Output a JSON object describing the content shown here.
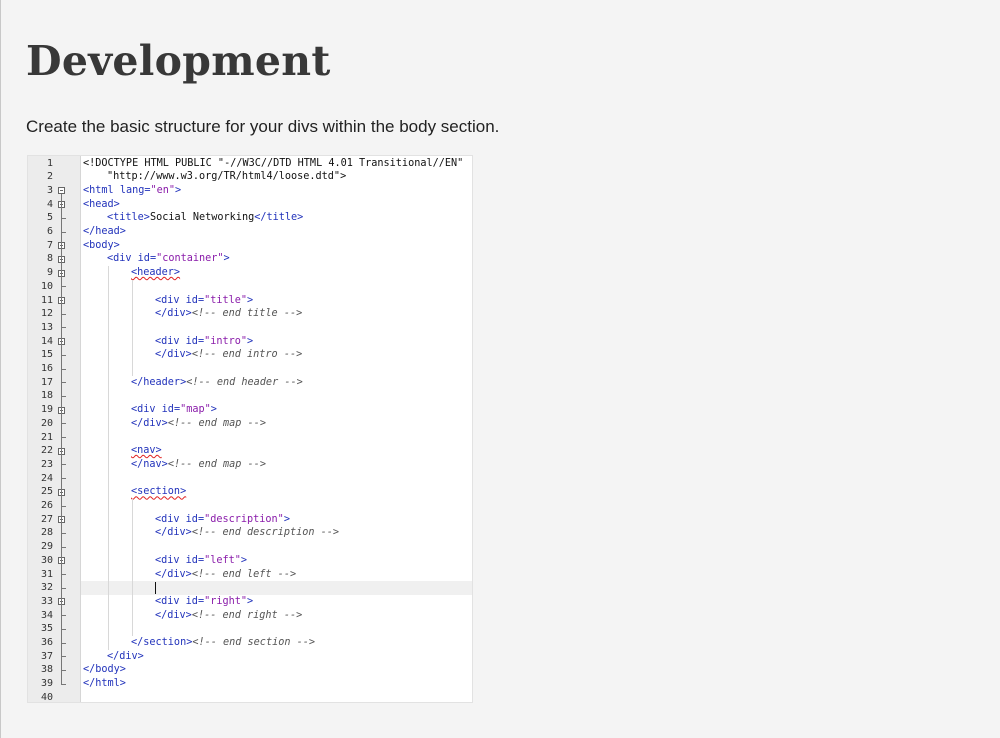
{
  "heading": "Development",
  "intro": "Create the basic structure for your divs within the body section.",
  "editor": {
    "cursor_line": 32,
    "lines": [
      {
        "n": "1",
        "indent": 0,
        "tokens": [
          [
            "doc",
            "<!DOCTYPE HTML PUBLIC \"-//W3C//DTD HTML 4.01 Transitional//EN\""
          ]
        ]
      },
      {
        "n": "2",
        "indent": 1,
        "tokens": [
          [
            "doc",
            "\"http://www.w3.org/TR/html4/loose.dtd\">"
          ]
        ]
      },
      {
        "n": "3",
        "indent": 0,
        "tokens": [
          [
            "tag",
            "<html "
          ],
          [
            "attr",
            "lang="
          ],
          [
            "val",
            "\"en\""
          ],
          [
            "tag",
            ">"
          ]
        ]
      },
      {
        "n": "4",
        "indent": 0,
        "tokens": [
          [
            "tag",
            "<head>"
          ]
        ]
      },
      {
        "n": "5",
        "indent": 1,
        "tokens": [
          [
            "tag",
            "<title>"
          ],
          [
            "txt",
            "Social Networking"
          ],
          [
            "tag",
            "</title>"
          ]
        ]
      },
      {
        "n": "6",
        "indent": 0,
        "tokens": [
          [
            "tag",
            "</head>"
          ]
        ]
      },
      {
        "n": "7",
        "indent": 0,
        "tokens": [
          [
            "tag",
            "<body>"
          ]
        ]
      },
      {
        "n": "8",
        "indent": 1,
        "tokens": [
          [
            "tag",
            "<div "
          ],
          [
            "attr",
            "id="
          ],
          [
            "val",
            "\"container\""
          ],
          [
            "tag",
            ">"
          ]
        ]
      },
      {
        "n": "9",
        "indent": 2,
        "tokens": [
          [
            "err",
            "<header>"
          ]
        ]
      },
      {
        "n": "10",
        "indent": 0,
        "tokens": []
      },
      {
        "n": "11",
        "indent": 3,
        "tokens": [
          [
            "tag",
            "<div "
          ],
          [
            "attr",
            "id="
          ],
          [
            "val",
            "\"title\""
          ],
          [
            "tag",
            ">"
          ]
        ]
      },
      {
        "n": "12",
        "indent": 3,
        "tokens": [
          [
            "tag",
            "</div>"
          ],
          [
            "cmt",
            "<!-- end title -->"
          ]
        ]
      },
      {
        "n": "13",
        "indent": 0,
        "tokens": []
      },
      {
        "n": "14",
        "indent": 3,
        "tokens": [
          [
            "tag",
            "<div "
          ],
          [
            "attr",
            "id="
          ],
          [
            "val",
            "\"intro\""
          ],
          [
            "tag",
            ">"
          ]
        ]
      },
      {
        "n": "15",
        "indent": 3,
        "tokens": [
          [
            "tag",
            "</div>"
          ],
          [
            "cmt",
            "<!-- end intro -->"
          ]
        ]
      },
      {
        "n": "16",
        "indent": 0,
        "tokens": []
      },
      {
        "n": "17",
        "indent": 2,
        "tokens": [
          [
            "tag",
            "</header>"
          ],
          [
            "cmt",
            "<!-- end header -->"
          ]
        ]
      },
      {
        "n": "18",
        "indent": 0,
        "tokens": []
      },
      {
        "n": "19",
        "indent": 2,
        "tokens": [
          [
            "tag",
            "<div "
          ],
          [
            "attr",
            "id="
          ],
          [
            "val",
            "\"map\""
          ],
          [
            "tag",
            ">"
          ]
        ]
      },
      {
        "n": "20",
        "indent": 2,
        "tokens": [
          [
            "tag",
            "</div>"
          ],
          [
            "cmt",
            "<!-- end map -->"
          ]
        ]
      },
      {
        "n": "21",
        "indent": 0,
        "tokens": []
      },
      {
        "n": "22",
        "indent": 2,
        "tokens": [
          [
            "err",
            "<nav>"
          ]
        ]
      },
      {
        "n": "23",
        "indent": 2,
        "tokens": [
          [
            "tag",
            "</nav>"
          ],
          [
            "cmt",
            "<!-- end map -->"
          ]
        ]
      },
      {
        "n": "24",
        "indent": 0,
        "tokens": []
      },
      {
        "n": "25",
        "indent": 2,
        "tokens": [
          [
            "err",
            "<section>"
          ]
        ]
      },
      {
        "n": "26",
        "indent": 0,
        "tokens": []
      },
      {
        "n": "27",
        "indent": 3,
        "tokens": [
          [
            "tag",
            "<div "
          ],
          [
            "attr",
            "id="
          ],
          [
            "val",
            "\"description\""
          ],
          [
            "tag",
            ">"
          ]
        ]
      },
      {
        "n": "28",
        "indent": 3,
        "tokens": [
          [
            "tag",
            "</div>"
          ],
          [
            "cmt",
            "<!-- end description -->"
          ]
        ]
      },
      {
        "n": "29",
        "indent": 0,
        "tokens": []
      },
      {
        "n": "30",
        "indent": 3,
        "tokens": [
          [
            "tag",
            "<div "
          ],
          [
            "attr",
            "id="
          ],
          [
            "val",
            "\"left\""
          ],
          [
            "tag",
            ">"
          ]
        ]
      },
      {
        "n": "31",
        "indent": 3,
        "tokens": [
          [
            "tag",
            "</div>"
          ],
          [
            "cmt",
            "<!-- end left -->"
          ]
        ]
      },
      {
        "n": "32",
        "indent": 0,
        "tokens": []
      },
      {
        "n": "33",
        "indent": 3,
        "tokens": [
          [
            "tag",
            "<div "
          ],
          [
            "attr",
            "id="
          ],
          [
            "val",
            "\"right\""
          ],
          [
            "tag",
            ">"
          ]
        ]
      },
      {
        "n": "34",
        "indent": 3,
        "tokens": [
          [
            "tag",
            "</div>"
          ],
          [
            "cmt",
            "<!-- end right -->"
          ]
        ]
      },
      {
        "n": "35",
        "indent": 0,
        "tokens": []
      },
      {
        "n": "36",
        "indent": 2,
        "tokens": [
          [
            "tag",
            "</section>"
          ],
          [
            "cmt",
            "<!-- end section -->"
          ]
        ]
      },
      {
        "n": "37",
        "indent": 1,
        "tokens": [
          [
            "tag",
            "</div>"
          ]
        ]
      },
      {
        "n": "38",
        "indent": 0,
        "tokens": [
          [
            "tag",
            "</body>"
          ]
        ]
      },
      {
        "n": "39",
        "indent": 0,
        "tokens": [
          [
            "tag",
            "</html>"
          ]
        ]
      },
      {
        "n": "40",
        "indent": 0,
        "tokens": []
      }
    ]
  }
}
